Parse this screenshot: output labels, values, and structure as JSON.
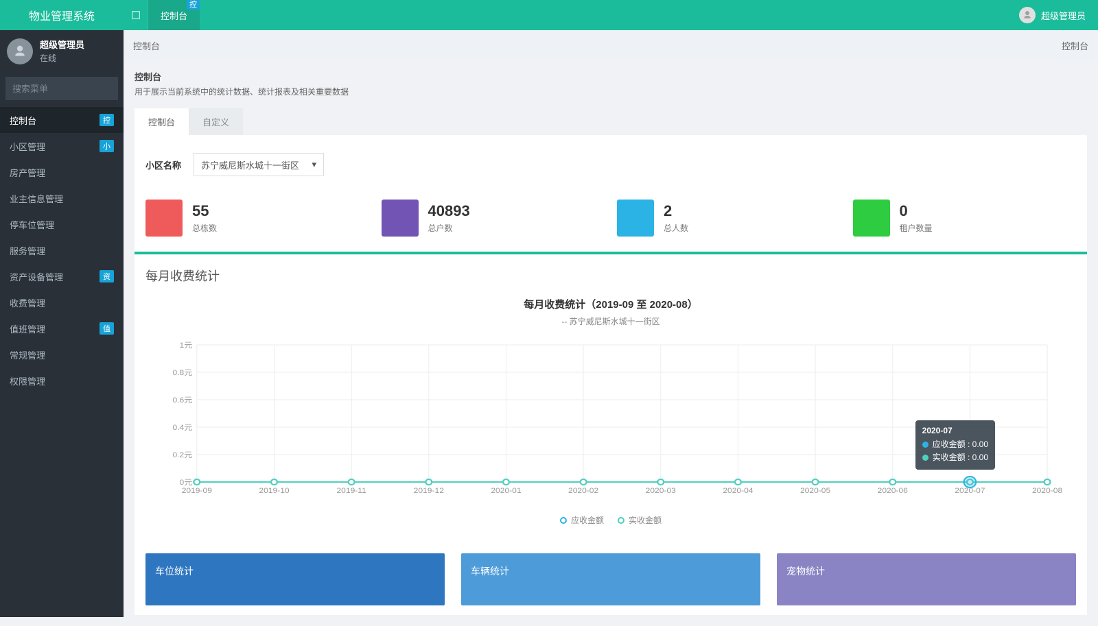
{
  "app_title": "物业管理系统",
  "topbar": {
    "tab_label": "控制台",
    "tab_badge": "控",
    "user_name": "超级管理员"
  },
  "sidebar": {
    "user": {
      "name": "超级管理员",
      "status": "在线"
    },
    "search_placeholder": "搜索菜单",
    "items": [
      {
        "label": "控制台",
        "badge": "控",
        "active": true
      },
      {
        "label": "小区管理",
        "badge": "小"
      },
      {
        "label": "房产管理"
      },
      {
        "label": "业主信息管理"
      },
      {
        "label": "停车位管理"
      },
      {
        "label": "服务管理"
      },
      {
        "label": "资产设备管理",
        "badge": "资"
      },
      {
        "label": "收费管理"
      },
      {
        "label": "值班管理",
        "badge": "值"
      },
      {
        "label": "常规管理"
      },
      {
        "label": "权限管理"
      }
    ]
  },
  "breadcrumb": {
    "left": "控制台",
    "right": "控制台"
  },
  "panel": {
    "title": "控制台",
    "desc": "用于展示当前系统中的统计数据、统计报表及相关重要数据"
  },
  "inner_tabs": [
    {
      "label": "控制台",
      "active": true
    },
    {
      "label": "自定义"
    }
  ],
  "filter": {
    "label": "小区名称",
    "value": "苏宁威尼斯水城十一街区"
  },
  "stats": [
    {
      "value": "55",
      "label": "总栋数",
      "color": "#ef5b5b"
    },
    {
      "value": "40893",
      "label": "总户数",
      "color": "#7154b4"
    },
    {
      "value": "2",
      "label": "总人数",
      "color": "#2bb3e5"
    },
    {
      "value": "0",
      "label": "租户数量",
      "color": "#2ecc40"
    }
  ],
  "chart_section_title": "每月收费统计",
  "chart_data": {
    "type": "line",
    "title": "每月收费统计（2019-09 至 2020-08）",
    "subtitle": "-- 苏宁威尼斯水城十一街区",
    "xlabel": "",
    "ylabel": "",
    "ylim": [
      0,
      1
    ],
    "y_unit": "元",
    "categories": [
      "2019-09",
      "2019-10",
      "2019-11",
      "2019-12",
      "2020-01",
      "2020-02",
      "2020-03",
      "2020-04",
      "2020-05",
      "2020-06",
      "2020-07",
      "2020-08"
    ],
    "y_ticks": [
      "0元",
      "0.2元",
      "0.4元",
      "0.6元",
      "0.8元",
      "1元"
    ],
    "series": [
      {
        "name": "应收金额",
        "color": "#2bb3e5",
        "values": [
          0,
          0,
          0,
          0,
          0,
          0,
          0,
          0,
          0,
          0,
          0,
          0
        ]
      },
      {
        "name": "实收金额",
        "color": "#4fd0bd",
        "values": [
          0,
          0,
          0,
          0,
          0,
          0,
          0,
          0,
          0,
          0,
          0,
          0
        ]
      }
    ],
    "tooltip": {
      "title": "2020-07",
      "rows": [
        {
          "label": "应收金额",
          "value": "0.00",
          "color": "#2bb3e5"
        },
        {
          "label": "实收金额",
          "value": "0.00",
          "color": "#4fd0bd"
        }
      ]
    }
  },
  "bottom_cards": [
    {
      "title": "车位统计",
      "color": "#2f76c0"
    },
    {
      "title": "车辆统计",
      "color": "#4d9bd8"
    },
    {
      "title": "宠物统计",
      "color": "#8a83c4"
    }
  ]
}
